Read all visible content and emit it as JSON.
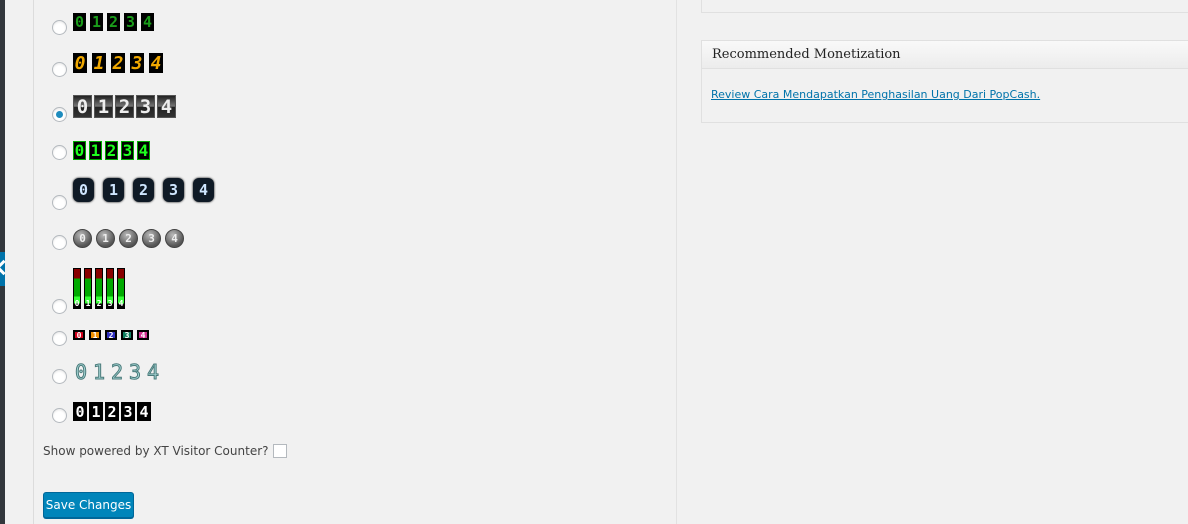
{
  "digits": [
    "0",
    "1",
    "2",
    "3",
    "4"
  ],
  "counter_styles": [
    {
      "selected": false
    },
    {
      "selected": false
    },
    {
      "selected": true
    },
    {
      "selected": false
    },
    {
      "selected": false
    },
    {
      "selected": false
    },
    {
      "selected": false
    },
    {
      "selected": false
    },
    {
      "selected": false
    },
    {
      "selected": false
    }
  ],
  "digit_colors_style8": [
    "#d0001a",
    "#f09000",
    "#3030c0",
    "#108060",
    "#d03090"
  ],
  "powered_label": "Show powered by XT Visitor Counter?",
  "powered_checked": false,
  "save_label": "Save Changes",
  "monetization": {
    "title": "Recommended Monetization",
    "link": "Review Cara Mendapatkan Penghasilan Uang Dari PopCash."
  },
  "colors": {
    "accent": "#0085ba",
    "link": "#0073aa"
  }
}
